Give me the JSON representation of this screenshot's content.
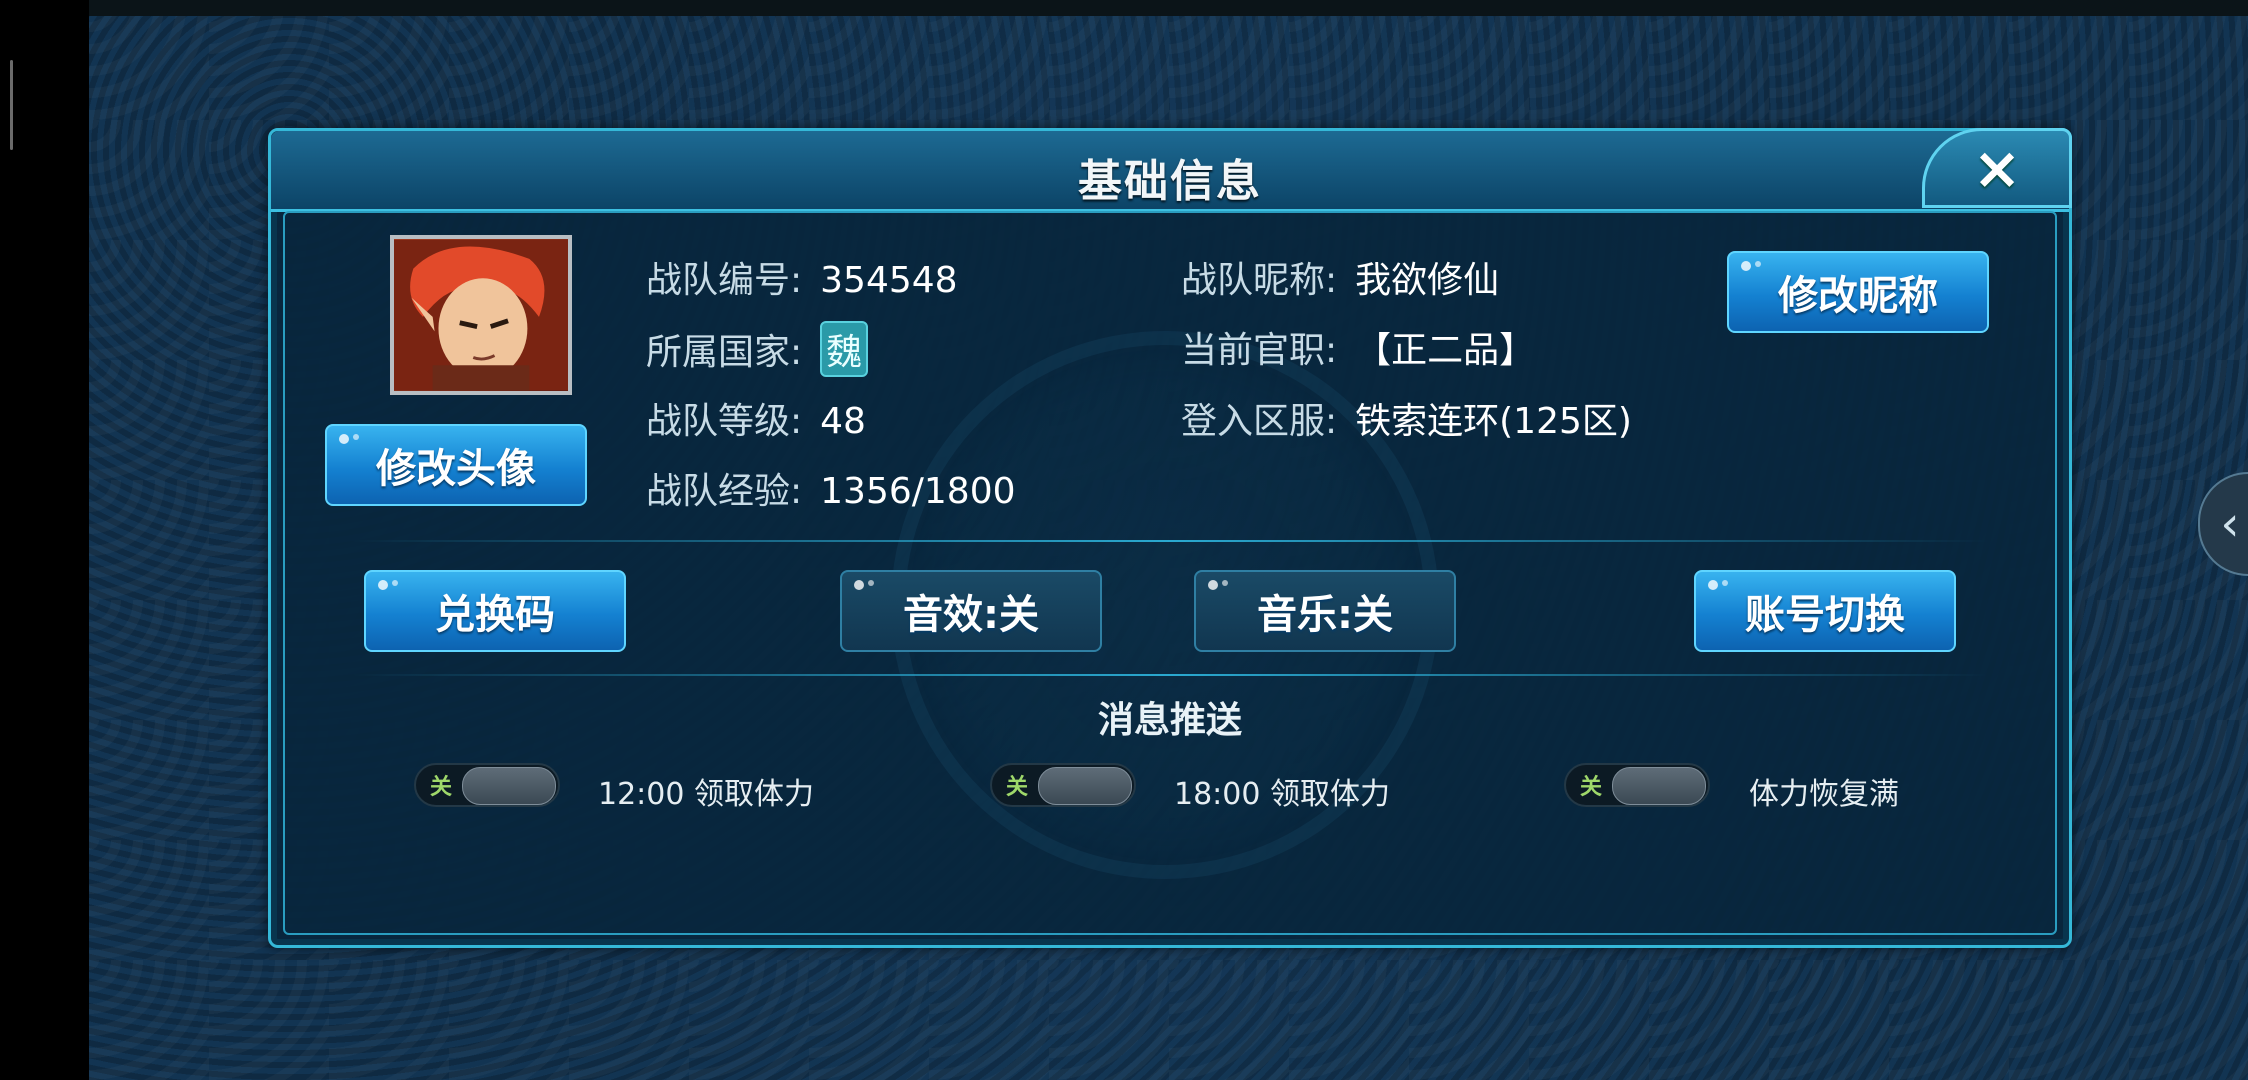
{
  "dialog": {
    "title": "基础信息",
    "close_icon": "×"
  },
  "profile": {
    "team_id_label": "战队编号:",
    "team_id_value": "354548",
    "team_nickname_label": "战队昵称:",
    "team_nickname_value": "我欲修仙",
    "country_label": "所属国家:",
    "country_value": "魏",
    "official_rank_label": "当前官职:",
    "official_rank_value": "【正二品】",
    "team_level_label": "战队等级:",
    "team_level_value": "48",
    "server_label": "登入区服:",
    "server_value": "铁索连环(125区)",
    "team_exp_label": "战队经验:",
    "team_exp_value": "1356/1800"
  },
  "buttons": {
    "change_avatar": "修改头像",
    "change_nickname": "修改昵称",
    "redeem_code": "兑换码",
    "sound_effects": "音效:关",
    "music": "音乐:关",
    "switch_account": "账号切换"
  },
  "push": {
    "section_title": "消息推送",
    "items": [
      {
        "toggle": "关",
        "label": "12:00  领取体力"
      },
      {
        "toggle": "关",
        "label": "18:00  领取体力"
      },
      {
        "toggle": "关",
        "label": "体力恢复满"
      }
    ]
  },
  "side": {
    "tab_icon": "‹"
  }
}
